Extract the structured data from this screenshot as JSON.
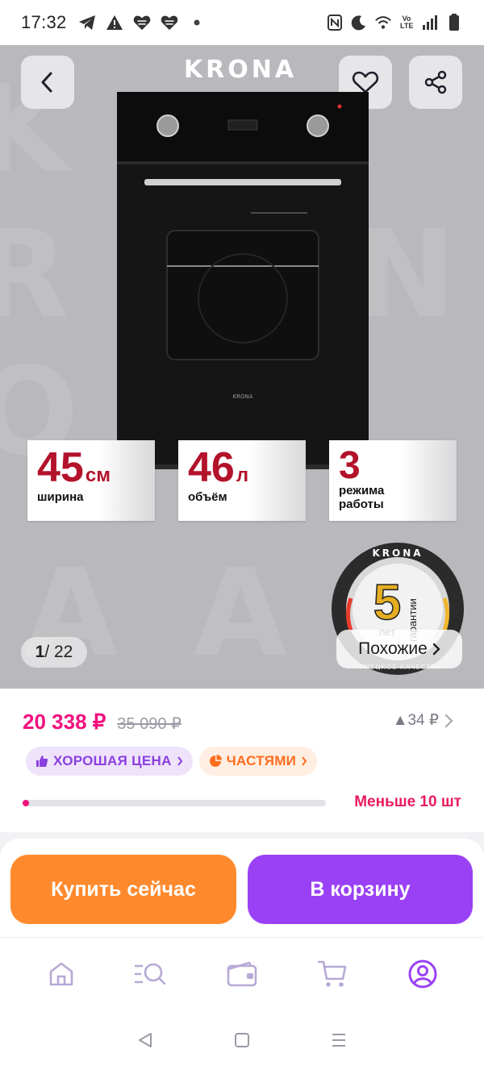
{
  "status_bar": {
    "time": "17:32",
    "left_icons": [
      "telegram-icon",
      "warning-icon",
      "heart-app-icon",
      "heart-app-icon",
      "dot-icon"
    ],
    "right_icons": [
      "nfc-icon",
      "moon-icon",
      "wifi-icon",
      "volte-icon",
      "signal-icon",
      "battery-icon"
    ],
    "volte_text": "Vo LTE"
  },
  "gallery": {
    "brand": "KRONA",
    "watermark_letters": [
      "K",
      "R",
      "O",
      "N",
      "A",
      "A"
    ],
    "page_current": "1",
    "page_separator": "/",
    "page_total": "22",
    "similar_label": "Похожие",
    "oven_brand": "KRONA",
    "specs": [
      {
        "value": "45",
        "unit": "см",
        "label": "ширина"
      },
      {
        "value": "46",
        "unit": "л",
        "label": "объём"
      },
      {
        "value": "3",
        "unit": "",
        "label_line1": "режима",
        "label_line2": "работы"
      }
    ],
    "warranty_badge": {
      "brand": "KRONA",
      "years": "5",
      "years_label": "лет",
      "guarantee": "гарантии",
      "quality": "НЕМЕЦКОЕ КАЧЕСТВО"
    }
  },
  "price": {
    "current": "20 338 ₽",
    "old": "35 090 ₽",
    "delta": "▲34 ₽",
    "chip_good": "ХОРОШАЯ ЦЕНА",
    "chip_parts": "ЧАСТЯМИ",
    "stock_label": "Меньше 10 шт",
    "stock_level_percent": 2
  },
  "actions": {
    "buy_now": "Купить сейчас",
    "add_to_cart": "В корзину"
  },
  "bottom_nav": [
    "home-icon",
    "catalog-search-icon",
    "wallet-icon",
    "cart-icon",
    "profile-icon"
  ],
  "colors": {
    "price_pink": "#f1117e",
    "buy_orange": "#ff8a2d",
    "cart_purple": "#9a41f5",
    "spec_red": "#b3122b",
    "active_nav": "#9a41f5"
  }
}
